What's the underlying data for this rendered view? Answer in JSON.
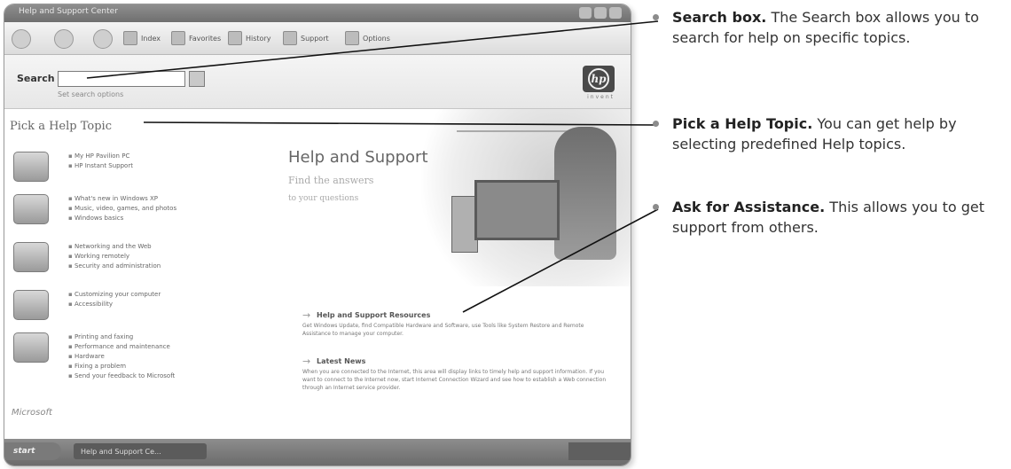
{
  "window": {
    "title": "Help and Support Center"
  },
  "toolbar": {
    "index_label": "Index",
    "favorites_label": "Favorites",
    "history_label": "History",
    "support_label": "Support",
    "options_label": "Options"
  },
  "search": {
    "label": "Search",
    "value": "",
    "set_options": "Set search options"
  },
  "brand": {
    "hp_mark": "hp",
    "hp_tagline": "invent"
  },
  "pick_topic": {
    "title": "Pick a Help Topic",
    "groups": [
      {
        "icon": "computer-icon",
        "items": [
          "My HP Pavilion PC",
          "HP Instant Support"
        ]
      },
      {
        "icon": "media-icon",
        "items": [
          "What's new in Windows XP",
          "Music, video, games, and photos",
          "Windows basics"
        ]
      },
      {
        "icon": "network-icon",
        "items": [
          "Networking and the Web",
          "Working remotely",
          "Security and administration"
        ]
      },
      {
        "icon": "customize-icon",
        "items": [
          "Customizing your computer",
          "Accessibility"
        ]
      },
      {
        "icon": "printer-icon",
        "items": [
          "Printing and faxing",
          "Performance and maintenance",
          "Hardware",
          "Fixing a problem",
          "Send your feedback to Microsoft"
        ]
      }
    ],
    "footer_logo": "Microsoft"
  },
  "main": {
    "title": "Help and Support",
    "sub1": "Find the answers",
    "sub2": "to your questions",
    "resources_head": "Help and Support Resources",
    "resources_text": "Get Windows Update, find Compatible Hardware and Software, use Tools like System Restore and Remote Assistance to manage your computer.",
    "news_head": "Latest News",
    "news_text": "When you are connected to the Internet, this area will display links to timely help and support information. If you want to connect to the Internet now, start Internet Connection Wizard and see how to establish a Web connection through an Internet service provider."
  },
  "taskbar": {
    "start": "start",
    "task": "Help and Support Ce..."
  },
  "callouts": [
    {
      "term": "Search box.",
      "text": " The Search box allows you to search for help on specific topics."
    },
    {
      "term": "Pick a Help Topic.",
      "text": " You can get help by selecting predefined Help topics."
    },
    {
      "term": "Ask for Assistance.",
      "text": " This allows you to get support from others."
    }
  ]
}
